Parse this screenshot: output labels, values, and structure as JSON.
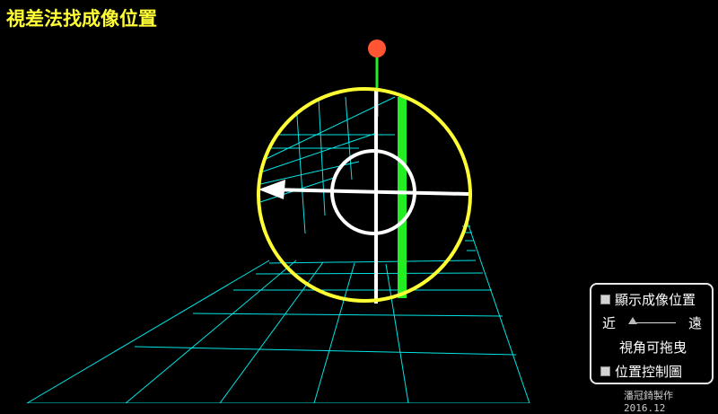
{
  "title": "視差法找成像位置",
  "colors": {
    "title": "#ffff33",
    "grid": "#00e5e5",
    "ring": "#ffff33",
    "crosshair": "#ffffff",
    "rod": "#22ee22",
    "ball": "#ff5533",
    "credit": "#cccccc"
  },
  "panel": {
    "show_image_position": {
      "label": "顯示成像位置",
      "checked": false
    },
    "distance_slider": {
      "near_label": "近",
      "far_label": "遠",
      "value": 0
    },
    "drag_hint": "視角可拖曳",
    "position_control": {
      "label": "位置控制圖",
      "checked": false
    }
  },
  "credit": "潘冠錡製作 2016.12"
}
